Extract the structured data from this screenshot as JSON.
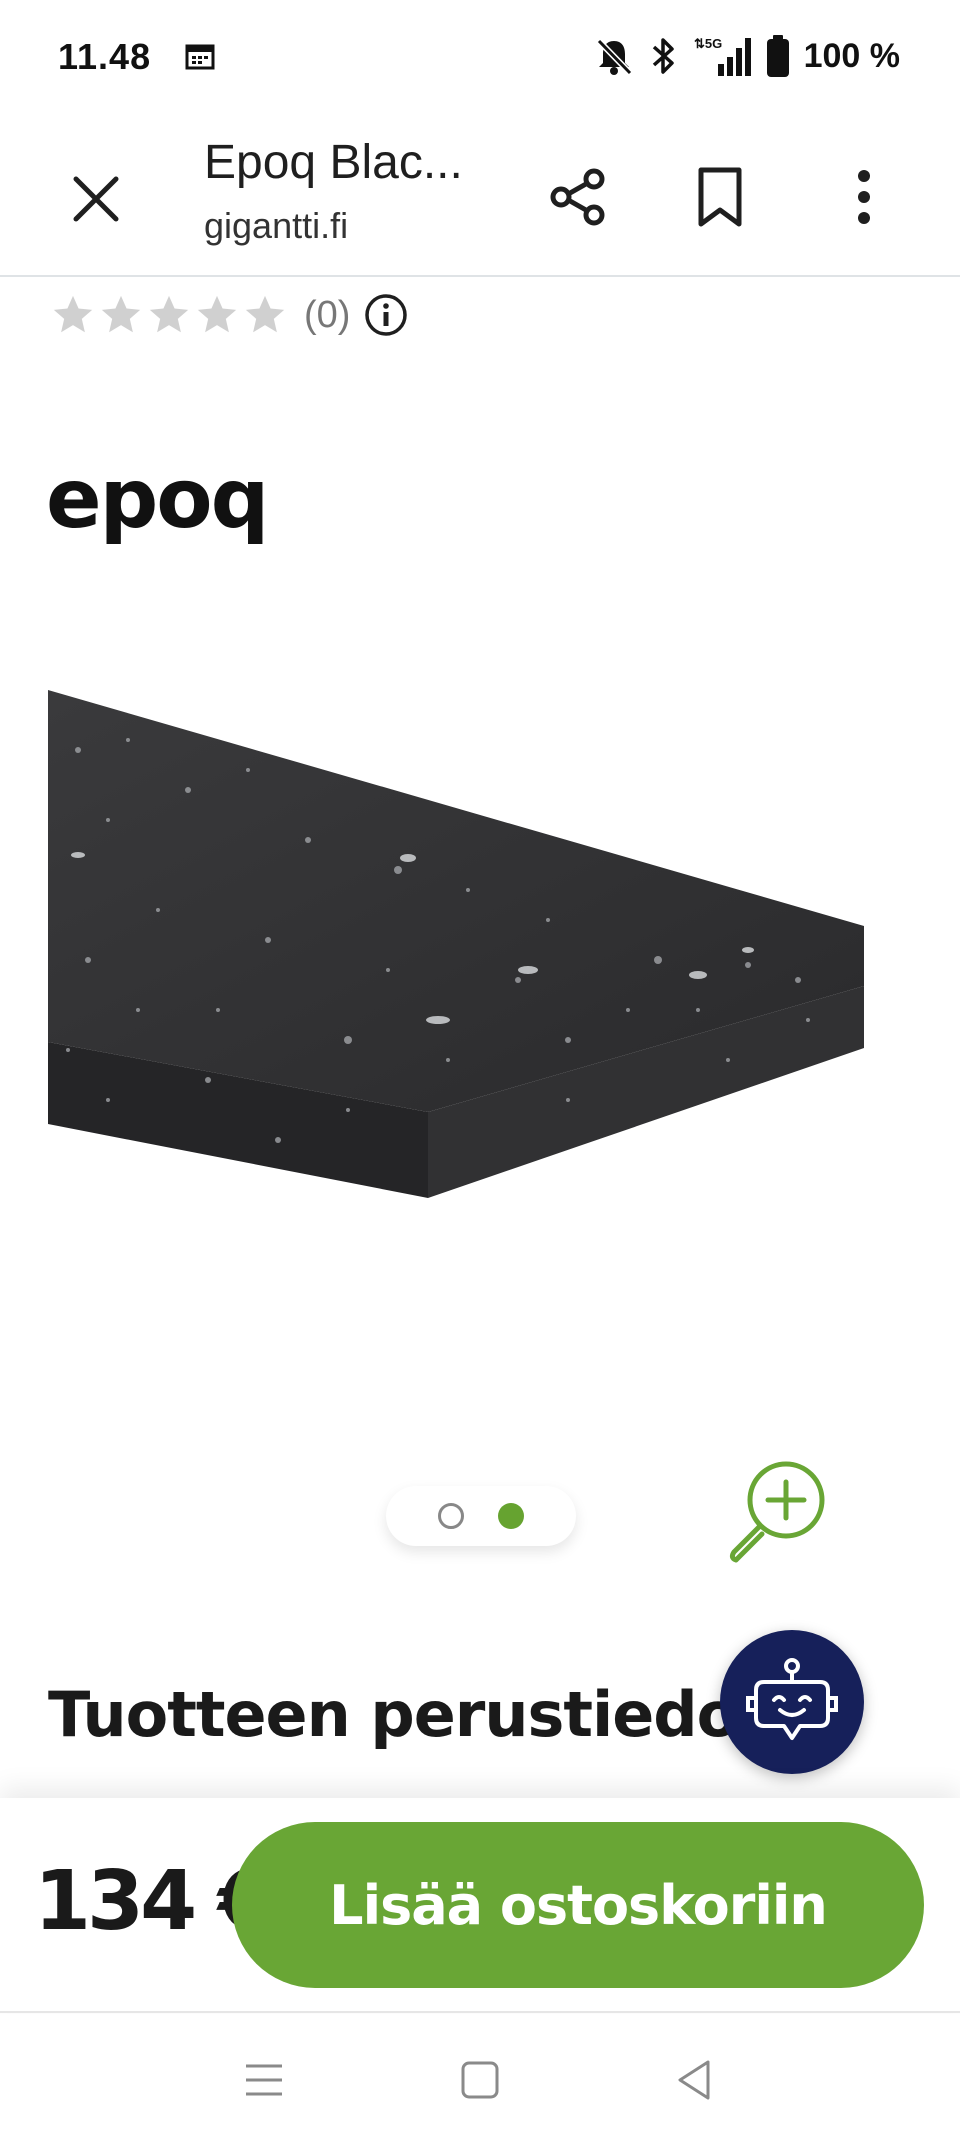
{
  "status_bar": {
    "time": "11.48",
    "battery": "100 %",
    "network": "5G"
  },
  "browser": {
    "title": "Epoq Blac...",
    "domain": "gigantti.fi"
  },
  "rating": {
    "stars": 0,
    "max_stars": 5,
    "count": "(0)"
  },
  "product": {
    "brand": "epoq",
    "carousel_active_index": 1,
    "carousel_total": 2
  },
  "section": {
    "heading": "Tuotteen perustiedot"
  },
  "purchase": {
    "price": "134 €",
    "add_to_cart_label": "Lisää ostoskoriin"
  },
  "colors": {
    "accent_green": "#69a635",
    "chatbot_navy": "#16205a",
    "star_gray": "#d0d0d0"
  },
  "icons": {
    "close": "close-icon",
    "share": "share-icon",
    "bookmark": "bookmark-icon",
    "menu": "more-vert-icon",
    "info": "info-icon",
    "zoom": "zoom-in-icon",
    "chatbot": "robot-icon"
  }
}
